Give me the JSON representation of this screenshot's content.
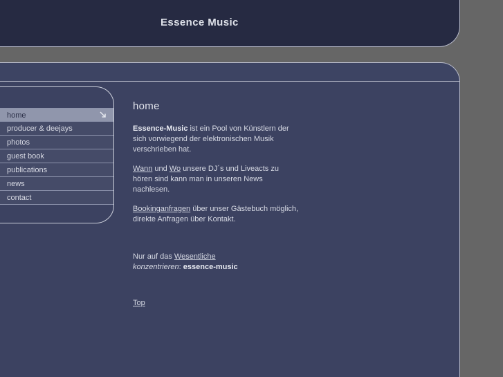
{
  "site": {
    "header_title": "Essence Music",
    "colors": {
      "page_background": "#666666",
      "header_bar": "#262a42",
      "sub_band": "#3d4463",
      "body_panel": "#3c4261",
      "border_light": "#b9bccb",
      "nav_item_background": "#454b68",
      "nav_item_active_background": "#9096ac",
      "text": "#d6d9e3"
    }
  },
  "sidebar": {
    "items": [
      {
        "label": "home",
        "active": true,
        "icon": "arrow-down-right-icon"
      },
      {
        "label": "producer & deejays",
        "active": false
      },
      {
        "label": "photos",
        "active": false
      },
      {
        "label": "guest book",
        "active": false
      },
      {
        "label": "publications",
        "active": false
      },
      {
        "label": "news",
        "active": false
      },
      {
        "label": "contact",
        "active": false
      }
    ]
  },
  "main": {
    "page_title": "home",
    "paragraph1": {
      "bold_lead": "Essence-Music",
      "rest": " ist ein Pool von Künstlern der sich vorwiegend der elektronischen Musik verschrieben hat."
    },
    "paragraph2": {
      "link1": "Wann",
      "between": " und ",
      "link2": "Wo",
      "rest": " unsere DJ´s und Liveacts zu hören sind kann man in unseren News nachlesen."
    },
    "paragraph3": {
      "link1": "Bookinganfragen",
      "rest": " über unser Gästebuch möglich, direkte Anfragen über Kontakt."
    },
    "tagline": {
      "prefix": "Nur auf das ",
      "link": "Wesentliche",
      "italic": "konzentrieren",
      "colon": ": ",
      "bold": "essence-music"
    },
    "top_link": "Top"
  }
}
